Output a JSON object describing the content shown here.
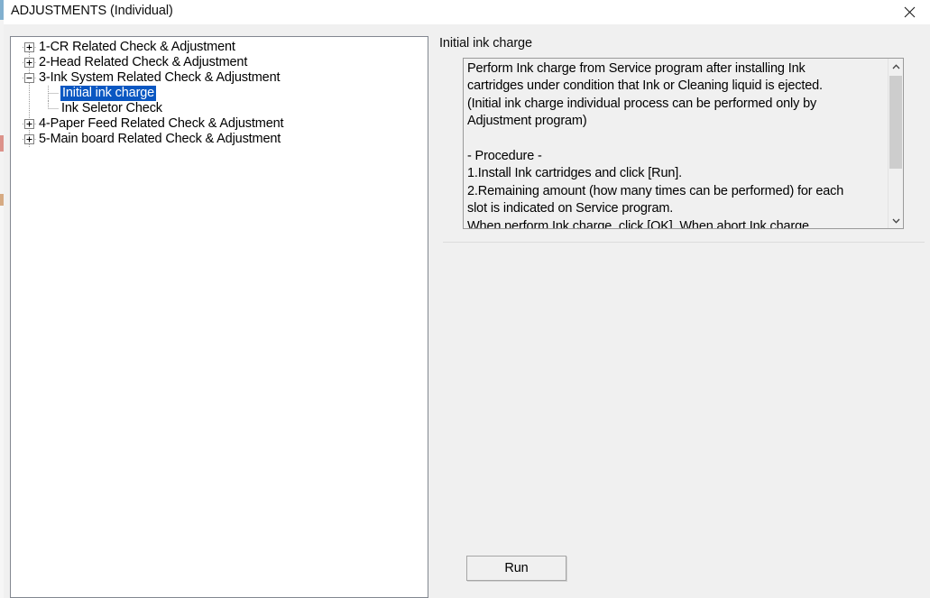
{
  "window": {
    "title": "ADJUSTMENTS (Individual)",
    "close_icon": "close-icon"
  },
  "tree": {
    "nodes": [
      {
        "label": "1-CR Related Check & Adjustment",
        "level": 0,
        "expander": "plus-box-icon",
        "selected": false
      },
      {
        "label": "2-Head Related Check & Adjustment",
        "level": 0,
        "expander": "plus-box-icon",
        "selected": false
      },
      {
        "label": "3-Ink System Related Check & Adjustment",
        "level": 0,
        "expander": "minus-box-icon",
        "selected": false
      },
      {
        "label": "Initial ink charge",
        "level": 1,
        "expander": "elbow-tee",
        "selected": true
      },
      {
        "label": "Ink Seletor Check",
        "level": 1,
        "expander": "elbow-end",
        "selected": false
      },
      {
        "label": "4-Paper Feed Related Check & Adjustment",
        "level": 0,
        "expander": "plus-box-icon",
        "selected": false
      },
      {
        "label": "5-Main board Related Check & Adjustment",
        "level": 0,
        "expander": "plus-box-icon",
        "selected": false
      }
    ]
  },
  "detail": {
    "title": "Initial ink charge",
    "description": "Perform Ink charge from Service program after installing Ink cartridges under condition that Ink or Cleaning liquid is ejected.\n(Initial ink charge individual process can be performed only by Adjustment program)\n\n- Procedure -\n1.Install Ink cartridges and click [Run].\n2.Remaining amount (how many times can be performed) for each slot is indicated on Service program.\nWhen perform Ink charge, click [OK]. When abort Ink charge,",
    "scrollbar": {
      "up_arrow_icon": "chevron-up-icon",
      "down_arrow_icon": "chevron-down-icon"
    },
    "run_label": "Run"
  },
  "colors": {
    "selection_blue": "#0a57c2",
    "window_background": "#f0f0f0",
    "panel_background": "#ffffff",
    "border": "#828790"
  }
}
